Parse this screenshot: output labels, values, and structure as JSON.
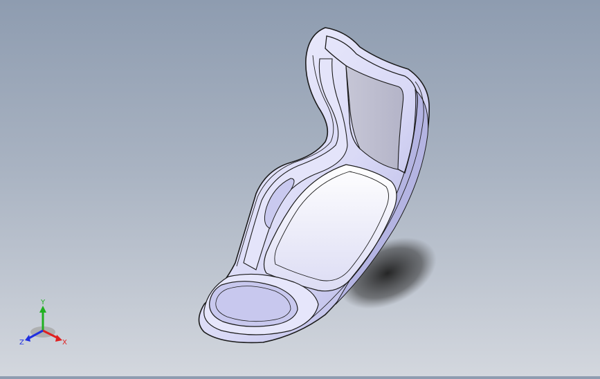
{
  "view": {
    "background_top": "#8e9cb0",
    "background_bottom": "#d3d7de",
    "model_color": "#e8e8fb",
    "model_shade": "#b9b9e6",
    "edge_color": "#1a1a1a"
  },
  "triad": {
    "x_label": "X",
    "y_label": "Y",
    "z_label": "Z",
    "x_color": "#e02020",
    "y_color": "#20b020",
    "z_color": "#2030e0"
  }
}
